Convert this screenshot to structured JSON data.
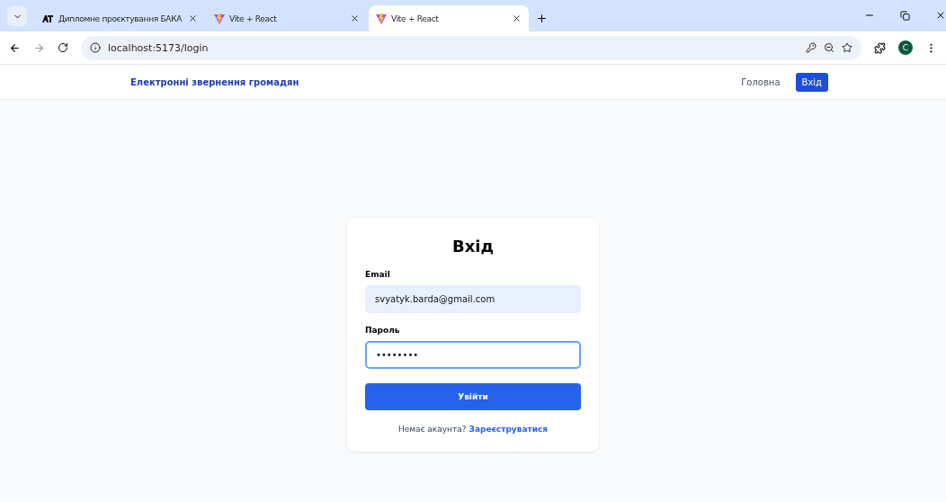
{
  "browser": {
    "tabs": [
      {
        "label": "Дипломне проєктування БАКА",
        "kind": "document",
        "selected": false
      },
      {
        "label": "Vite + React",
        "kind": "app",
        "selected": false
      },
      {
        "label": "Vite + React",
        "kind": "app",
        "selected": true
      }
    ],
    "address": "localhost:5173/login",
    "profile": "C"
  },
  "navbar": {
    "brand": "Електронні звернення громадян",
    "links": [
      {
        "label": "Головна",
        "selected": false
      },
      {
        "label": "Вхід",
        "selected": true
      }
    ]
  },
  "login": {
    "title": "Вхід",
    "fields": [
      {
        "label": "Email",
        "value": "svyatyk.barda@gmail.com",
        "focused": false,
        "autofilled": true
      },
      {
        "label": "Пароль",
        "value": "••••••••",
        "focused": true,
        "autofilled": false
      }
    ],
    "submit": "Увійти",
    "footer": "Немає акаунта?",
    "link": "Зареєструватися"
  }
}
